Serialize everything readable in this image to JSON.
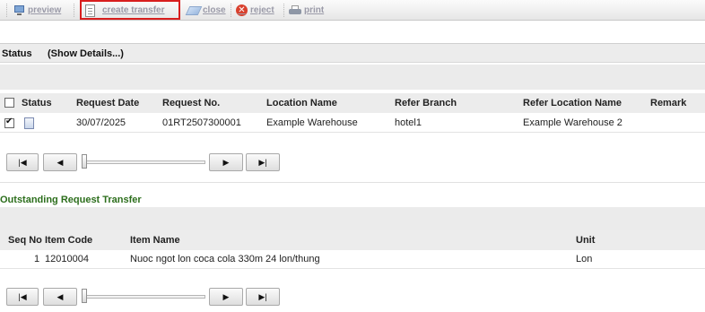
{
  "toolbar": {
    "preview": "preview",
    "create_transfer": "create transfer",
    "close": "close",
    "reject": "reject",
    "print": "print"
  },
  "status_bar": {
    "title": "Status",
    "details": "(Show Details...)"
  },
  "requests": {
    "columns": [
      "Status",
      "Request Date",
      "Request No.",
      "Location Name",
      "Refer Branch",
      "Refer Location Name",
      "Remark"
    ],
    "rows": [
      {
        "checked": true,
        "request_date": "30/07/2025",
        "request_no": "01RT2507300001",
        "location_name": "Example Warehouse",
        "refer_branch": "hotel1",
        "refer_location_name": "Example Warehouse 2",
        "remark": ""
      }
    ]
  },
  "outstanding": {
    "title": "Outstanding Request Transfer",
    "columns": [
      "Seq No",
      "Item Code",
      "Item Name",
      "Unit"
    ],
    "rows": [
      {
        "seq_no": "1",
        "item_code": "12010004",
        "item_name": "Nuoc ngot lon coca cola 330m 24 lon/thung",
        "unit": "Lon"
      }
    ]
  },
  "pager": {
    "first": "|◀",
    "prev": "◀",
    "next": "▶",
    "last": "▶|"
  },
  "colors": {
    "highlight": "#d81e1e",
    "section_title": "#2c6e1c"
  }
}
